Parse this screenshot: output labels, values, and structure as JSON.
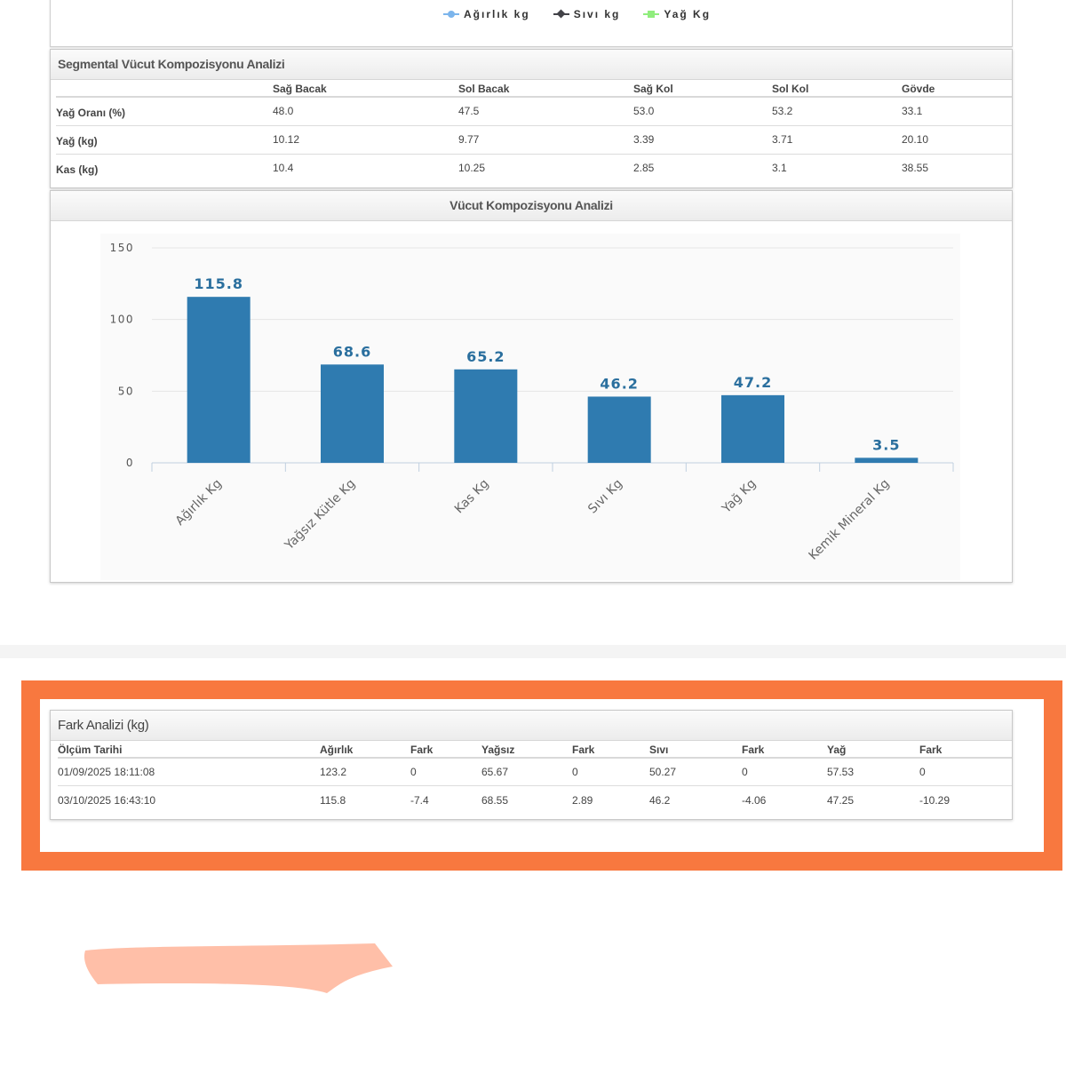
{
  "legend": {
    "items": [
      {
        "label": "Ağırlık kg",
        "color": "#7cb5ec",
        "marker": "circle"
      },
      {
        "label": "Sıvı kg",
        "color": "#434348",
        "marker": "diamond"
      },
      {
        "label": "Yağ Kg",
        "color": "#90ed7d",
        "marker": "square"
      }
    ]
  },
  "segmental": {
    "title": "Segmental Vücut Kompozisyonu Analizi",
    "columns": [
      "",
      "Sağ Bacak",
      "Sol Bacak",
      "Sağ Kol",
      "Sol Kol",
      "Gövde"
    ],
    "rows": [
      [
        "Yağ Oranı (%)",
        "48.0",
        "47.5",
        "53.0",
        "53.2",
        "33.1"
      ],
      [
        "Yağ (kg)",
        "10.12",
        "9.77",
        "3.39",
        "3.71",
        "20.10"
      ],
      [
        "Kas (kg)",
        "10.4",
        "10.25",
        "2.85",
        "3.1",
        "38.55"
      ]
    ]
  },
  "composition": {
    "title": "Vücut Kompozisyonu Analizi"
  },
  "chart_data": {
    "type": "bar",
    "categories": [
      "Ağırlık Kg",
      "Yağsız Kütle Kg",
      "Kas Kg",
      "Sıvı Kg",
      "Yağ Kg",
      "Kemik Mineral Kg"
    ],
    "values": [
      115.8,
      68.6,
      65.2,
      46.2,
      47.2,
      3.5
    ],
    "ylim": [
      0,
      150
    ],
    "yticks": [
      0,
      50,
      100,
      150
    ],
    "grid": true,
    "bar_color": "#2f7bb0",
    "label_color": "#2a6f9e"
  },
  "difference": {
    "title": "Fark Analizi (kg)",
    "columns": [
      "Ölçüm Tarihi",
      "Ağırlık",
      "Fark",
      "Yağsız",
      "Fark",
      "Sıvı",
      "Fark",
      "Yağ",
      "Fark"
    ],
    "rows": [
      [
        "01/09/2025 18:11:08",
        "123.2",
        "0",
        "65.67",
        "0",
        "50.27",
        "0",
        "57.53",
        "0"
      ],
      [
        "03/10/2025 16:43:10",
        "115.8",
        "-7.4",
        "68.55",
        "2.89",
        "46.2",
        "-4.06",
        "47.25",
        "-10.29"
      ]
    ],
    "highlight_color": "#f8783f"
  }
}
